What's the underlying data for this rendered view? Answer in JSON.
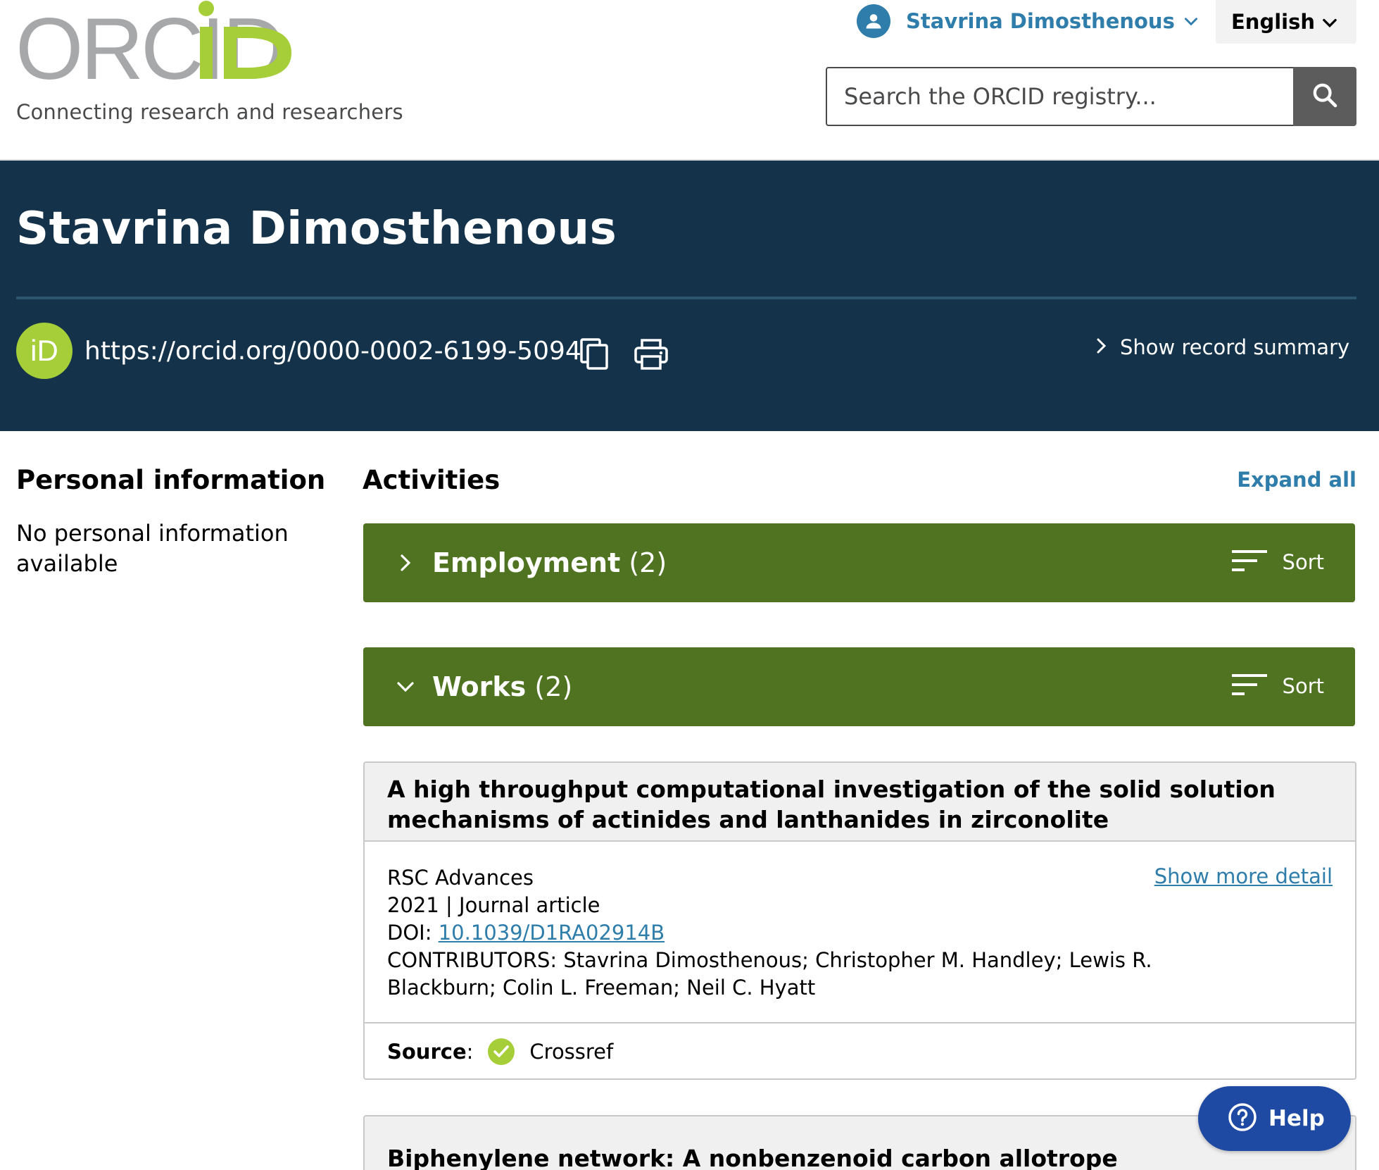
{
  "header": {
    "logo_text": "ORCID",
    "tagline": "Connecting research and researchers",
    "user_name": "Stavrina Dimosthenous",
    "language": "English",
    "search_placeholder": "Search the ORCID registry...",
    "search_icon": "magnifier-icon"
  },
  "record": {
    "name": "Stavrina Dimosthenous",
    "orcid_url": "https://orcid.org/0000-0002-6199-5094",
    "summary_toggle": "Show record summary",
    "id_badge": "iD"
  },
  "personal": {
    "heading": "Personal information",
    "text": "No personal information available"
  },
  "activities": {
    "heading": "Activities",
    "expand_all": "Expand all",
    "sections": [
      {
        "title": "Employment",
        "count": "(2)",
        "sort_label": "Sort",
        "expanded": false
      },
      {
        "title": "Works",
        "count": "(2)",
        "sort_label": "Sort",
        "expanded": true
      }
    ]
  },
  "works": [
    {
      "title": "A high throughput computational investigation of the solid solution mechanisms of actinides and lanthanides in zirconolite",
      "journal": "RSC Advances",
      "year_type": "2021 | Journal article",
      "doi_label": "DOI:",
      "doi": "10.1039/D1RA02914B",
      "contributors_line1": "CONTRIBUTORS: Stavrina Dimosthenous; Christopher M. Handley; Lewis R.",
      "contributors_line2": "Blackburn; Colin L. Freeman; Neil C. Hyatt",
      "show_more": "Show more detail",
      "source_label": "Source",
      "source_colon": ":",
      "source_name": "Crossref"
    },
    {
      "title": "Biphenylene network: A nonbenzenoid carbon allotrope"
    }
  ],
  "help": {
    "label": "Help"
  },
  "colors": {
    "banner": "#14324a",
    "section_green": "#4f7321",
    "orcid_green": "#a6ce39",
    "link_blue": "#2e7dab",
    "help_blue": "#1e4aa3"
  }
}
